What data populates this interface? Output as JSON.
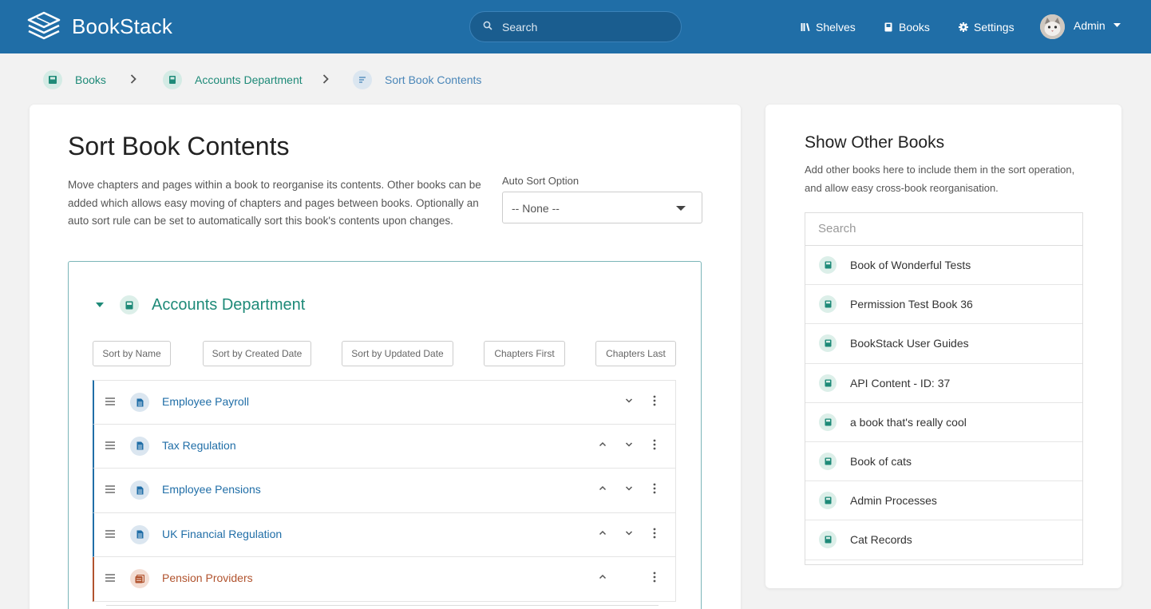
{
  "header": {
    "brand": "BookStack",
    "search_placeholder": "Search",
    "nav": [
      {
        "label": "Shelves",
        "icon": "shelves-icon"
      },
      {
        "label": "Books",
        "icon": "book-icon"
      },
      {
        "label": "Settings",
        "icon": "gear-icon"
      }
    ],
    "user": "Admin"
  },
  "breadcrumb": [
    {
      "label": "Books",
      "icon": "books-icon"
    },
    {
      "label": "Accounts Department",
      "icon": "book-icon"
    },
    {
      "label": "Sort Book Contents",
      "icon": "sort-icon"
    }
  ],
  "main": {
    "title": "Sort Book Contents",
    "description": "Move chapters and pages within a book to reorganise its contents. Other books can be added which allows easy moving of chapters and pages between books. Optionally an auto sort rule can be set to automatically sort this book's contents upon changes.",
    "auto_sort_label": "Auto Sort Option",
    "auto_sort_value": "-- None --",
    "book_name": "Accounts Department",
    "sort_buttons": [
      "Sort by Name",
      "Sort by Created Date",
      "Sort by Updated Date",
      "Chapters First",
      "Chapters Last"
    ],
    "items": [
      {
        "label": "Employee Payroll",
        "type": "page",
        "up": false,
        "down": true
      },
      {
        "label": "Tax Regulation",
        "type": "page",
        "up": true,
        "down": true
      },
      {
        "label": "Employee Pensions",
        "type": "page",
        "up": true,
        "down": true
      },
      {
        "label": "UK Financial Regulation",
        "type": "page",
        "up": true,
        "down": true
      },
      {
        "label": "Pension Providers",
        "type": "chapter",
        "up": true,
        "down": false
      }
    ]
  },
  "side": {
    "title": "Show Other Books",
    "description": "Add other books here to include them in the sort operation, and allow easy cross-book reorganisation.",
    "search_placeholder": "Search",
    "books": [
      "Book of Wonderful Tests",
      "Permission Test Book 36",
      "BookStack User Guides",
      "API Content - ID: 37",
      "a book that's really cool",
      "Book of cats",
      "Admin Processes",
      "Cat Records"
    ]
  },
  "colors": {
    "header": "#206ea7",
    "book": "#1e8a78",
    "page": "#206ea7",
    "chapter": "#b1532e"
  }
}
